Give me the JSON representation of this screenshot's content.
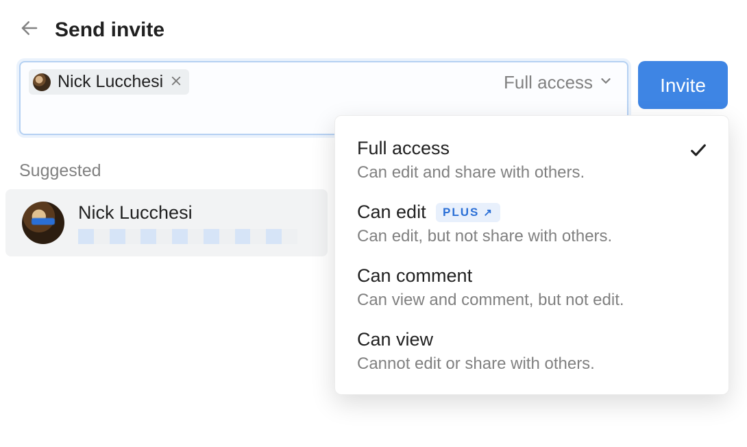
{
  "header": {
    "title": "Send invite"
  },
  "input": {
    "chip_name": "Nick Lucchesi",
    "access_label": "Full access"
  },
  "invite_button": "Invite",
  "suggested": {
    "label": "Suggested",
    "items": [
      {
        "name": "Nick Lucchesi"
      }
    ]
  },
  "dropdown": {
    "options": [
      {
        "title": "Full access",
        "desc": "Can edit and share with others.",
        "selected": true
      },
      {
        "title": "Can edit",
        "desc": "Can edit, but not share with others.",
        "plus": true
      },
      {
        "title": "Can comment",
        "desc": "Can view and comment, but not edit."
      },
      {
        "title": "Can view",
        "desc": "Cannot edit or share with others."
      }
    ],
    "plus_badge": "PLUS"
  }
}
